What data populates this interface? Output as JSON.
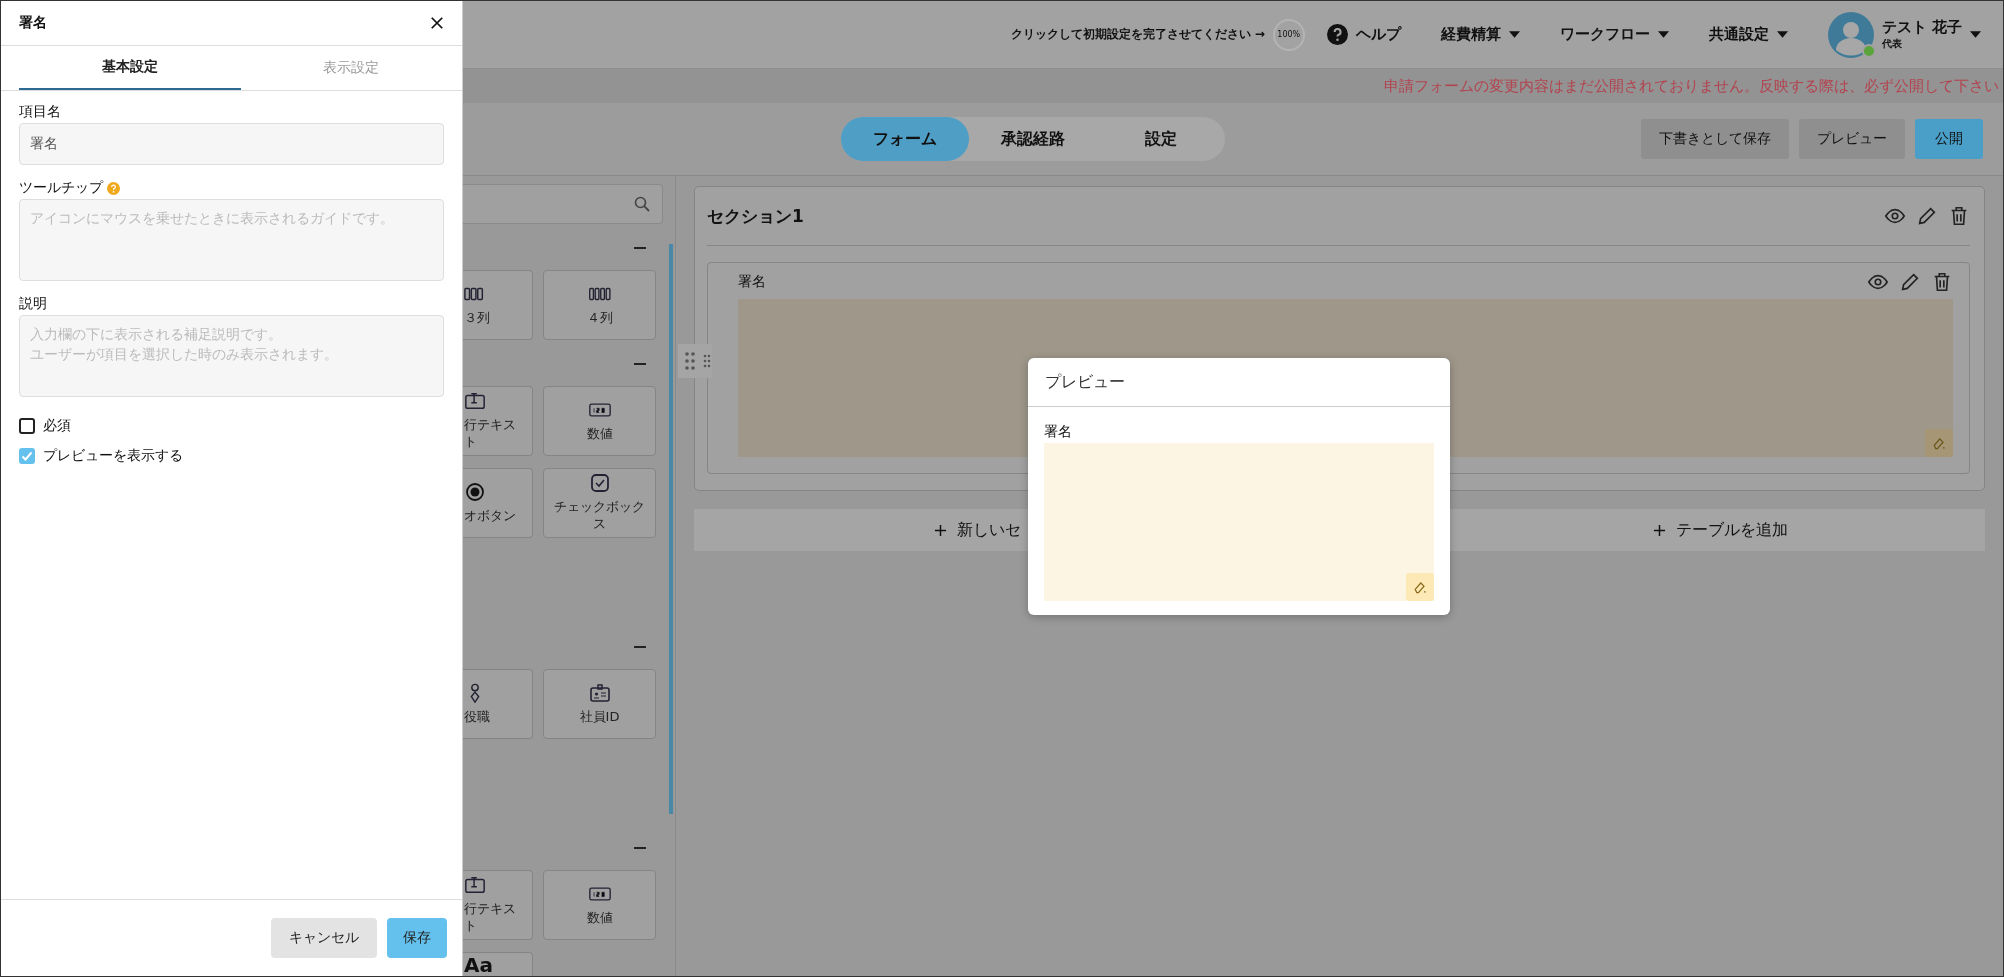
{
  "header": {
    "setup_prompt": "クリックして初期設定を完了させてください →",
    "progress": "100%",
    "menus": [
      {
        "label": "ヘルプ",
        "kind": "help"
      },
      {
        "label": "経費精算",
        "kind": "dropdown"
      },
      {
        "label": "ワークフロー",
        "kind": "dropdown"
      },
      {
        "label": "共通設定",
        "kind": "dropdown"
      }
    ],
    "user": {
      "name": "テスト 花子",
      "role": "代表"
    }
  },
  "notice": "申請フォームの変更内容はまだ公開されておりません。反映する際は、必ず公開して下さい",
  "editor_tabs": [
    {
      "label": "フォーム",
      "selected": true
    },
    {
      "label": "承認経路",
      "selected": false
    },
    {
      "label": "設定",
      "selected": false
    }
  ],
  "actions": [
    {
      "label": "下書きとして保存",
      "kind": "secondary"
    },
    {
      "label": "プレビュー",
      "kind": "secondary"
    },
    {
      "label": "公開",
      "kind": "primary"
    }
  ],
  "palette": {
    "groups": [
      {
        "items": [
          {
            "kind": "columns3",
            "label": "３列"
          },
          {
            "kind": "columns4",
            "label": "４列"
          }
        ]
      },
      {
        "items": [
          {
            "kind": "text",
            "label": "行テキスト"
          },
          {
            "kind": "number",
            "label": "数値"
          },
          {
            "kind": "radio",
            "label": "オボタン"
          },
          {
            "kind": "checkbox",
            "label": "チェックボックス"
          }
        ]
      },
      {
        "items": [
          {
            "kind": "position",
            "label": "役職"
          },
          {
            "kind": "employee",
            "label": "社員ID"
          }
        ]
      },
      {
        "items": [
          {
            "kind": "text",
            "label": "行テキスト"
          },
          {
            "kind": "number",
            "label": "数値"
          },
          {
            "kind": "glyph",
            "label": "Aa"
          }
        ]
      }
    ]
  },
  "section": {
    "title": "セクション1",
    "fields": [
      {
        "label": "署名",
        "kind": "signature"
      }
    ]
  },
  "add_buttons": [
    {
      "label": "新しいセ"
    },
    {
      "label": "テーブルを追加"
    }
  ],
  "drawer": {
    "title": "署名",
    "tabs": [
      {
        "label": "基本設定",
        "selected": true
      },
      {
        "label": "表示設定",
        "selected": false
      }
    ],
    "fields": [
      {
        "label": "項目名",
        "kind": "input",
        "value": "署名",
        "help": false
      },
      {
        "label": "ツールチップ",
        "kind": "textarea",
        "placeholder": "アイコンにマウスを乗せたときに表示されるガイドです。",
        "help": true
      },
      {
        "label": "説明",
        "kind": "textarea",
        "placeholder": "入力欄の下に表示される補足説明です。ユーザーが項目を選択した時のみ表示されます。",
        "help": false
      }
    ],
    "checks": [
      {
        "label": "必須",
        "checked": false
      },
      {
        "label": "プレビューを表示する",
        "checked": true
      }
    ],
    "buttons": [
      {
        "label": "キャンセル",
        "kind": "secondary"
      },
      {
        "label": "保存",
        "kind": "primary"
      }
    ]
  },
  "preview": {
    "title": "プレビュー",
    "field_label": "署名"
  }
}
